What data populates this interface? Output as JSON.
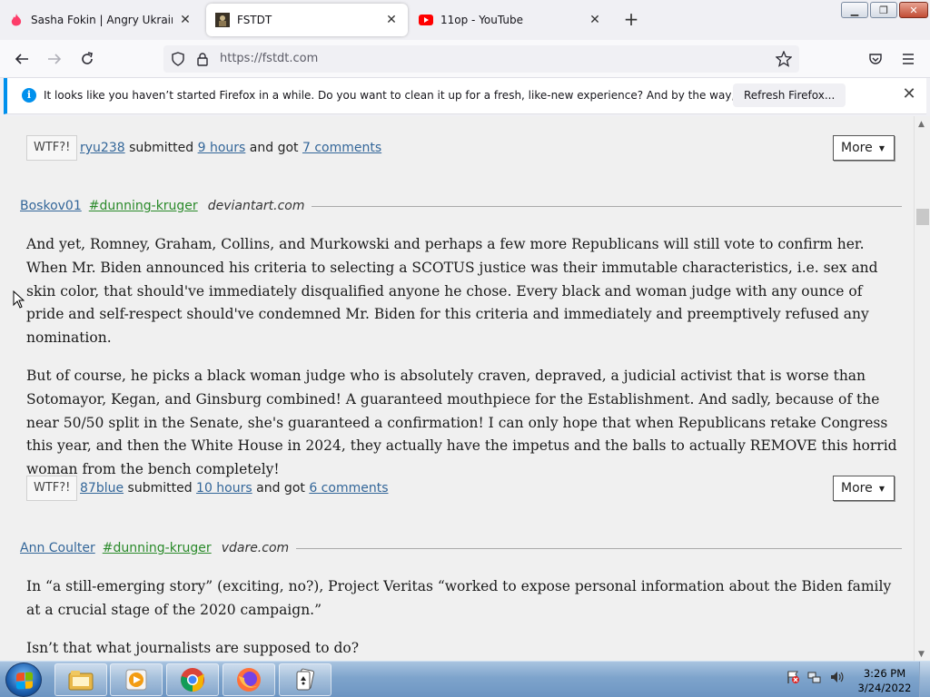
{
  "browser": {
    "tabs": [
      {
        "label": "Sasha Fokin | Angry Ukrainian K",
        "favicon": "tinder-flame-icon",
        "active": false
      },
      {
        "label": "FSTDT",
        "favicon": "fstdt-icon",
        "active": true
      },
      {
        "label": "11op - YouTube",
        "favicon": "youtube-icon",
        "active": false
      }
    ],
    "url": "https://fstdt.com",
    "notification": {
      "message": "It looks like you haven’t started Firefox in a while. Do you want to clean it up for a fresh, like-new experience? And by the way, welcome back!",
      "button_label": "Refresh Firefox..."
    }
  },
  "page": {
    "top_meta": {
      "badge": "WTF?!",
      "user": "ryu238",
      "submitted": "submitted",
      "time": "9 hours",
      "and_got": "and got",
      "comments": "7 comments",
      "more": "More"
    },
    "posts": [
      {
        "user": "Boskov01",
        "tag": "#dunning-kruger",
        "source": "deviantart.com",
        "paragraphs": [
          "And yet, Romney, Graham, Collins, and Murkowski and perhaps a few more Republicans will still vote to confirm her. When Mr. Biden announced his criteria to selecting a SCOTUS justice was their immutable characteristics, i.e. sex and skin color, that should've immediately disqualified anyone he chose. Every black and woman judge with any ounce of pride and self-respect should've condemned Mr. Biden for this criteria and immediately and preemptively refused any nomination.",
          "But of course, he picks a black woman judge who is absolutely craven, depraved, a judicial activist that is worse than Sotomayor, Kegan, and Ginsburg combined! A guaranteed mouthpiece for the Establishment. And sadly, because of the near 50/50 split in the Senate, she's guaranteed a confirmation! I can only hope that when Republicans retake Congress this year, and then the White House in 2024, they actually have the impetus and the balls to actually REMOVE this horrid woman from the bench completely!"
        ],
        "meta": {
          "badge": "WTF?!",
          "user": "87blue",
          "submitted": "submitted",
          "time": "10 hours",
          "and_got": "and got",
          "comments": "6 comments",
          "more": "More"
        }
      },
      {
        "user": "Ann Coulter",
        "tag": "#dunning-kruger",
        "source": "vdare.com",
        "paragraphs": [
          "In “a still-emerging story” (exciting, no?), Project Veritas “worked to expose personal information about the Biden family at a crucial stage of the 2020 campaign.”",
          "Isn’t that what journalists are supposed to do?"
        ]
      }
    ]
  },
  "taskbar": {
    "apps": [
      "file-explorer-icon",
      "media-player-icon",
      "chrome-icon",
      "firefox-icon",
      "solitaire-icon"
    ],
    "clock_time": "3:26 PM",
    "clock_date": "3/24/2022"
  },
  "colors": {
    "link": "#336699",
    "tag": "#2a8a2a",
    "notification_accent": "#0090ed"
  }
}
